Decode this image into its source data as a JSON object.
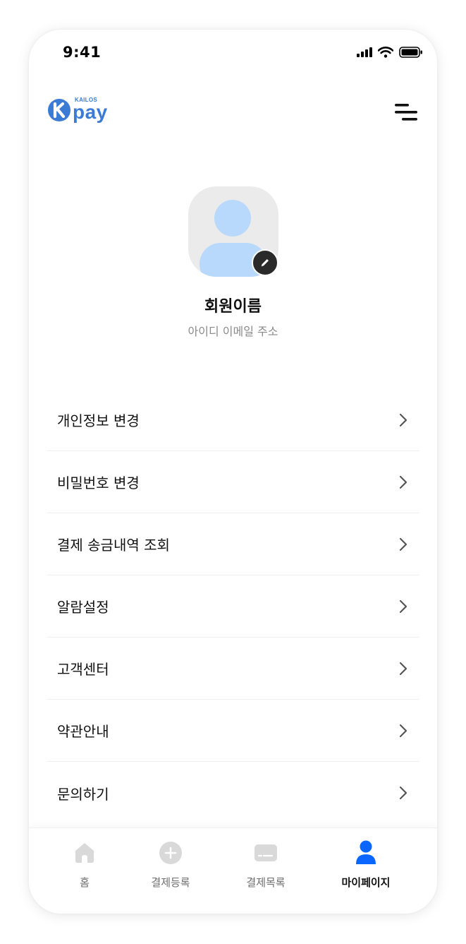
{
  "status_bar": {
    "time": "9:41"
  },
  "header": {
    "logo_top": "KAILOS",
    "logo_bottom": "pay"
  },
  "profile": {
    "name": "회원이름",
    "email": "아이디 이메일 주소"
  },
  "menu": [
    {
      "label": "개인정보 변경"
    },
    {
      "label": "비밀번호 변경"
    },
    {
      "label": "결제 송금내역 조회"
    },
    {
      "label": "알람설정"
    },
    {
      "label": "고객센터"
    },
    {
      "label": "약관안내"
    },
    {
      "label": "문의하기"
    }
  ],
  "tabs": [
    {
      "label": "홈",
      "icon": "home-icon",
      "active": false
    },
    {
      "label": "결제등록",
      "icon": "plus-circle-icon",
      "active": false
    },
    {
      "label": "결제목록",
      "icon": "card-list-icon",
      "active": false
    },
    {
      "label": "마이페이지",
      "icon": "person-icon",
      "active": true
    }
  ],
  "colors": {
    "brand": "#3a7bd5",
    "accent": "#0a66ff",
    "avatar_fill": "#b8d9fb",
    "inactive": "#d9d9d9"
  }
}
